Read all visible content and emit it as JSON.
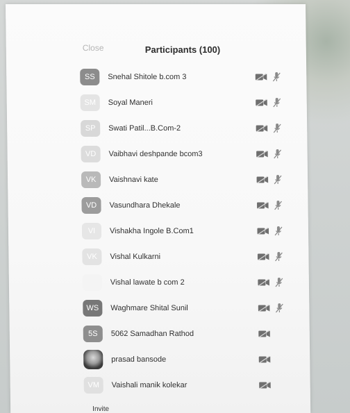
{
  "header": {
    "close_label": "Close",
    "title": "Participants (100)"
  },
  "participants": [
    {
      "initials": "SS",
      "name": "Snehal Shitole b.com 3",
      "avatar_color": "#8c8c8c",
      "avatar_type": "initials",
      "mic_muted": true
    },
    {
      "initials": "SM",
      "name": "Soyal Maneri",
      "avatar_color": "#e4e4e4",
      "avatar_type": "initials",
      "mic_muted": true
    },
    {
      "initials": "SP",
      "name": "Swati Patil...B.Com-2",
      "avatar_color": "#d8d8d8",
      "avatar_type": "initials",
      "mic_muted": true
    },
    {
      "initials": "VD",
      "name": "Vaibhavi deshpande bcom3",
      "avatar_color": "#dcdcdc",
      "avatar_type": "initials",
      "mic_muted": true
    },
    {
      "initials": "VK",
      "name": "Vaishnavi kate",
      "avatar_color": "#b9b9b9",
      "avatar_type": "initials",
      "mic_muted": true
    },
    {
      "initials": "VD",
      "name": "Vasundhara Dhekale",
      "avatar_color": "#9c9c9c",
      "avatar_type": "initials",
      "mic_muted": true
    },
    {
      "initials": "VI",
      "name": "Vishakha Ingole B.Com1",
      "avatar_color": "#e6e6e6",
      "avatar_type": "initials",
      "mic_muted": true
    },
    {
      "initials": "VK",
      "name": "Vishal Kulkarni",
      "avatar_color": "#e3e3e3",
      "avatar_type": "initials",
      "mic_muted": true
    },
    {
      "initials": "",
      "name": "Vishal lawate b com 2",
      "avatar_color": "#f4f4f4",
      "avatar_type": "initials",
      "mic_muted": true
    },
    {
      "initials": "WS",
      "name": "Waghmare Shital Sunil",
      "avatar_color": "#777777",
      "avatar_type": "initials",
      "mic_muted": true
    },
    {
      "initials": "5S",
      "name": "5062 Samadhan Rathod",
      "avatar_color": "#8e8e8e",
      "avatar_type": "initials",
      "mic_muted": false
    },
    {
      "initials": "",
      "name": "prasad bansode",
      "avatar_color": "#777777",
      "avatar_type": "photo",
      "mic_muted": false
    },
    {
      "initials": "VM",
      "name": "Vaishali manik kolekar",
      "avatar_color": "#e0e0e0",
      "avatar_type": "initials",
      "mic_muted": false
    }
  ],
  "footer": {
    "invite_label": "Invite"
  }
}
